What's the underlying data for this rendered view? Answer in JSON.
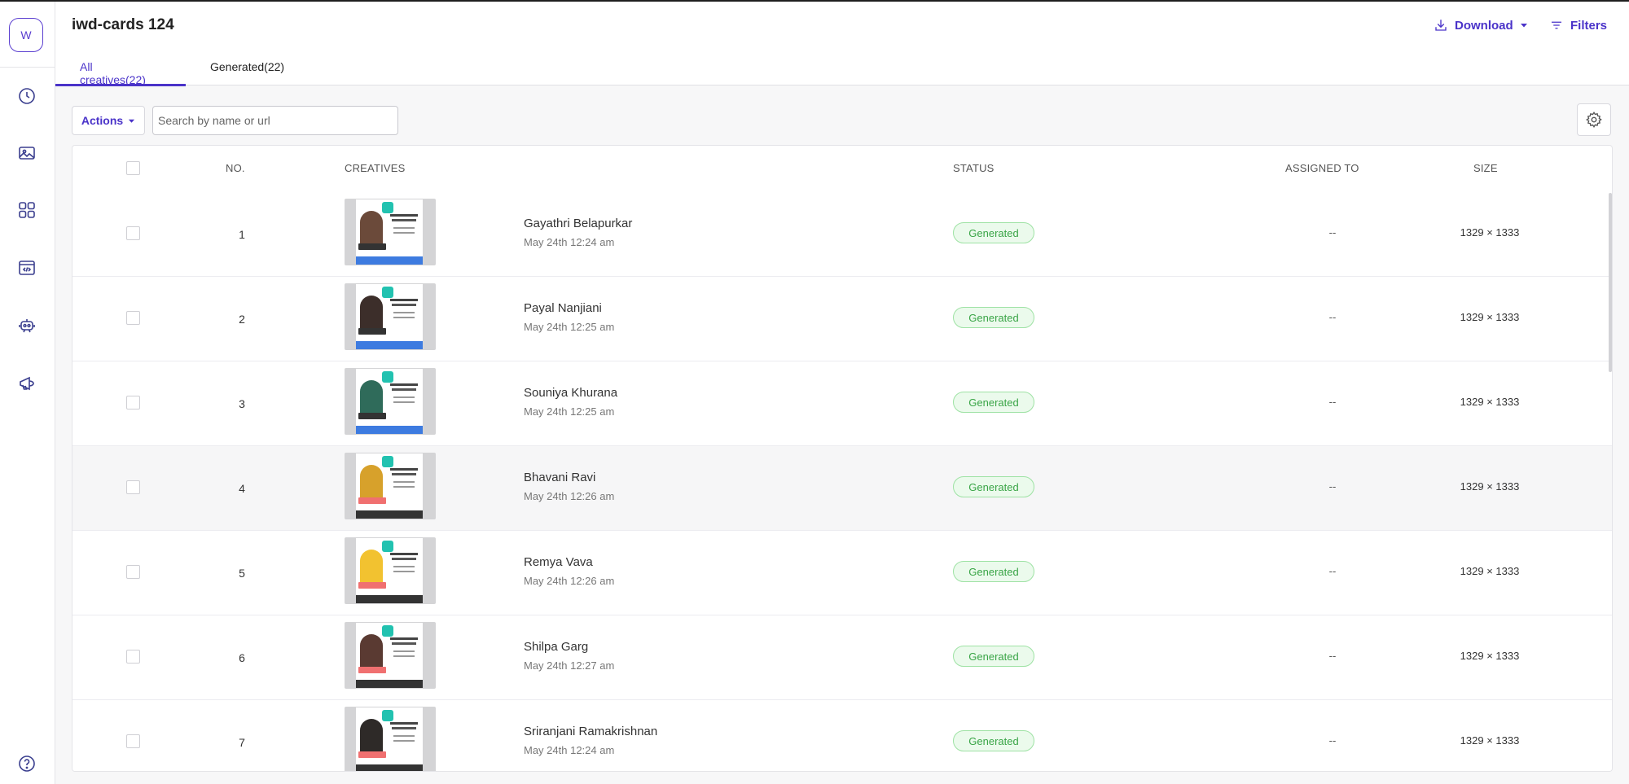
{
  "sidebar": {
    "avatar": "W",
    "nav": [
      "clock-icon",
      "image-icon",
      "grid-icon",
      "code-icon",
      "robot-icon",
      "announcement-icon",
      "help-icon"
    ]
  },
  "header": {
    "title": "iwd-cards 124",
    "download_label": "Download",
    "filters_label": "Filters",
    "tabs": [
      {
        "label": "All creatives(22)",
        "active": true
      },
      {
        "label": "Generated(22)",
        "active": false
      }
    ]
  },
  "toolbar": {
    "actions_label": "Actions",
    "search_placeholder": "Search by name or url",
    "search_value": ""
  },
  "table": {
    "columns": [
      "NO.",
      "CREATIVES",
      "STATUS",
      "ASSIGNED TO",
      "SIZE"
    ],
    "rows": [
      {
        "no": "1",
        "name": "Gayathri Belapurkar",
        "date": "May 24th 12:24 am",
        "status": "Generated",
        "assigned": "--",
        "size": "1329 × 1333"
      },
      {
        "no": "2",
        "name": "Payal Nanjiani",
        "date": "May 24th 12:25 am",
        "status": "Generated",
        "assigned": "--",
        "size": "1329 × 1333"
      },
      {
        "no": "3",
        "name": "Souniya Khurana",
        "date": "May 24th 12:25 am",
        "status": "Generated",
        "assigned": "--",
        "size": "1329 × 1333"
      },
      {
        "no": "4",
        "name": "Bhavani Ravi",
        "date": "May 24th 12:26 am",
        "status": "Generated",
        "assigned": "--",
        "size": "1329 × 1333"
      },
      {
        "no": "5",
        "name": "Remya Vava",
        "date": "May 24th 12:26 am",
        "status": "Generated",
        "assigned": "--",
        "size": "1329 × 1333"
      },
      {
        "no": "6",
        "name": "Shilpa Garg",
        "date": "May 24th 12:27 am",
        "status": "Generated",
        "assigned": "--",
        "size": "1329 × 1333"
      },
      {
        "no": "7",
        "name": "Sriranjani Ramakrishnan",
        "date": "May 24th 12:24 am",
        "status": "Generated",
        "assigned": "--",
        "size": "1329 × 1333"
      }
    ]
  },
  "colors": {
    "accent": "#4a33c9",
    "status_bg": "#ebfaec",
    "status_text": "#3aa547"
  }
}
